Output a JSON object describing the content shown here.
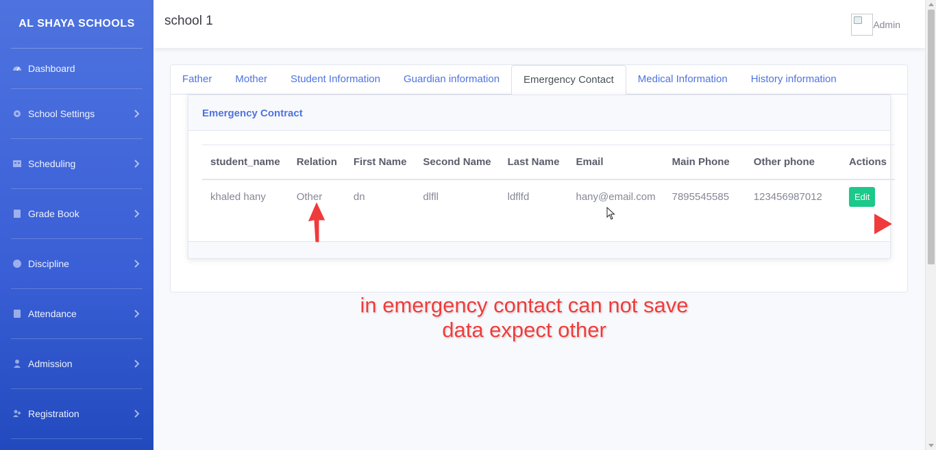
{
  "sidebar": {
    "brand": "AL SHAYA SCHOOLS",
    "items": [
      {
        "label": "Dashboard",
        "icon": "dashboard-icon"
      },
      {
        "label": "School Settings",
        "icon": "gear-icon"
      },
      {
        "label": "Scheduling",
        "icon": "calendar-icon"
      },
      {
        "label": "Grade Book",
        "icon": "book-icon"
      },
      {
        "label": "Discipline",
        "icon": "smile-icon"
      },
      {
        "label": "Attendance",
        "icon": "book-icon"
      },
      {
        "label": "Admission",
        "icon": "user-icon"
      },
      {
        "label": "Registration",
        "icon": "users-icon"
      }
    ]
  },
  "topbar": {
    "title": "school 1",
    "user_name": "Admin"
  },
  "tabs": [
    {
      "label": "Father"
    },
    {
      "label": "Mother"
    },
    {
      "label": "Student Information"
    },
    {
      "label": "Guardian information"
    },
    {
      "label": "Emergency Contact",
      "active": true
    },
    {
      "label": "Medical Information"
    },
    {
      "label": "History information"
    }
  ],
  "panel": {
    "title": "Emergency Contract",
    "columns": [
      "student_name",
      "Relation",
      "First Name",
      "Second Name",
      "Last Name",
      "Email",
      "Main Phone",
      "Other phone",
      "Actions"
    ],
    "rows": [
      {
        "student_name": "khaled hany",
        "relation": "Other",
        "first_name": "dn",
        "second_name": "dlfll",
        "last_name": "ldflfd",
        "email": "hany@email.com",
        "main_phone": "7895545585",
        "other_phone": "123456987012",
        "action_label": "Edit"
      }
    ]
  },
  "annotation": {
    "line1": "in emergency contact can not save",
    "line2": "data expect other"
  },
  "colors": {
    "sidebar": "#4e73df",
    "primary": "#4e73df",
    "success": "#1cc88a",
    "annotation": "#ef3b3b"
  }
}
